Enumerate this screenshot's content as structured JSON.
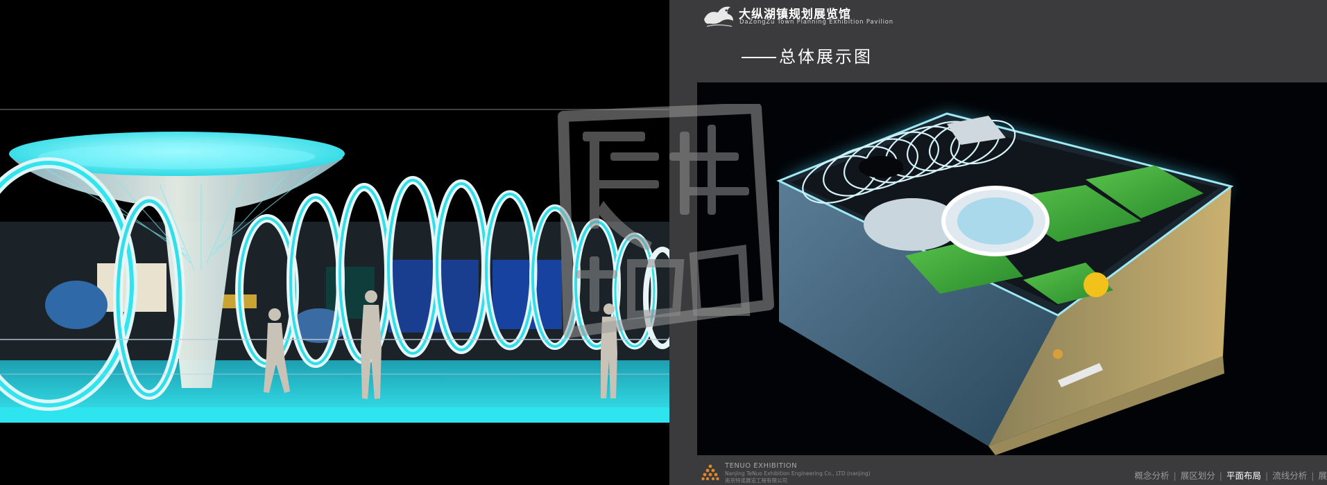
{
  "header": {
    "title_cn": "大纵湖镇规划展览馆",
    "title_en": "DaZongZu Town Planning Exhibition Pavilion",
    "subtitle": "总体展示图"
  },
  "footer": {
    "company_en": "TENUO EXHIBITION",
    "company_en_full": "Nanjing TeNuo Exhibition Engineering Co., LTD (nanjing)",
    "company_cn": "南京特诺展览工程有限公司"
  },
  "nav": {
    "items": [
      "概念分析",
      "展区划分",
      "平面布局",
      "流线分析",
      "展"
    ],
    "active_index": 2
  },
  "watermark": {
    "text": "特诺展"
  },
  "colors": {
    "glow_cyan": "#2fe6ef",
    "ring_white": "#e6f2f5",
    "panel_bg": "#3b3b3d",
    "grass_green": "#3fa83a"
  },
  "icons": {
    "header_logo": "dragon-logo-icon",
    "footer_logo": "tenuo-triangle-logo-icon"
  }
}
